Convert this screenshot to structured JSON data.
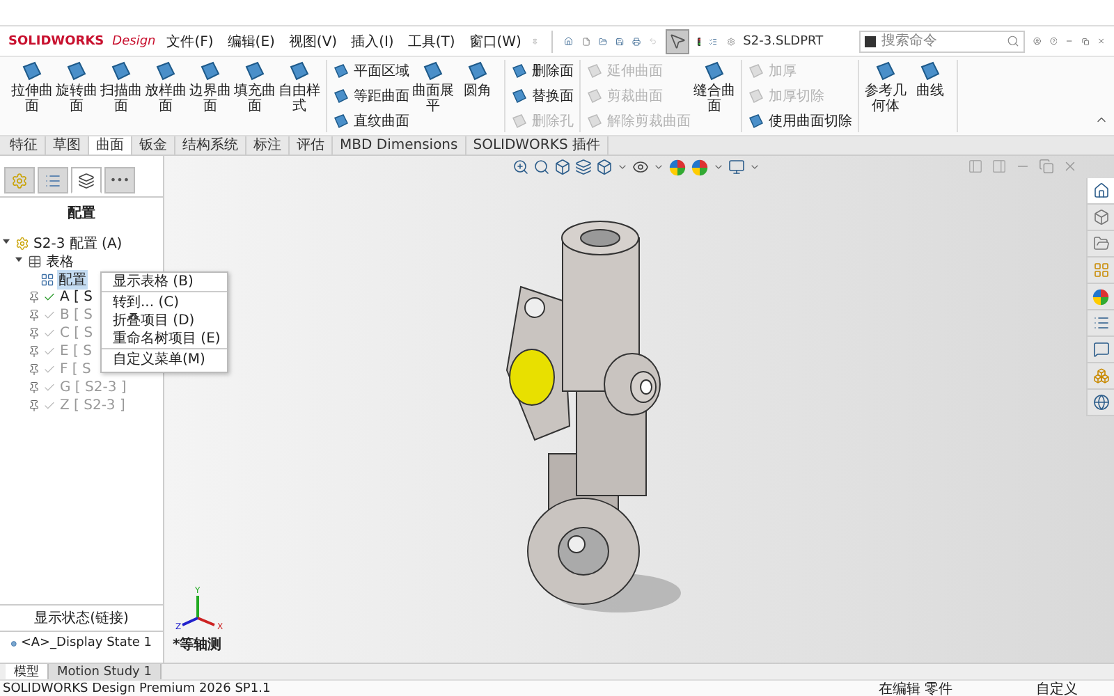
{
  "app": {
    "logo_brand": "SOLIDWORKS",
    "logo_product": "Design",
    "menus": [
      "文件(F)",
      "编辑(E)",
      "视图(V)",
      "插入(I)",
      "工具(T)",
      "窗口(W)"
    ],
    "file_title": "S2-3.SLDPRT",
    "search": {
      "placeholder": "搜索命令"
    }
  },
  "ribbon": {
    "groups": [
      {
        "items": [
          {
            "label": "拉伸曲面",
            "kind": "large",
            "disabled": false
          },
          {
            "label": "旋转曲面",
            "kind": "large",
            "disabled": false
          },
          {
            "label": "扫描曲面",
            "kind": "large",
            "disabled": false
          },
          {
            "label": "放样曲面",
            "kind": "large",
            "disabled": false
          },
          {
            "label": "边界曲面",
            "kind": "large",
            "disabled": false
          },
          {
            "label": "填充曲面",
            "kind": "large",
            "disabled": false
          },
          {
            "label": "自由样式",
            "kind": "large",
            "disabled": false
          }
        ]
      },
      {
        "items": [
          {
            "label": "平面区域",
            "kind": "small",
            "disabled": false
          },
          {
            "label": "等距曲面",
            "kind": "small",
            "disabled": false
          },
          {
            "label": "直纹曲面",
            "kind": "small",
            "disabled": false
          },
          {
            "label": "曲面展平",
            "kind": "large",
            "disabled": false
          },
          {
            "label": "圆角",
            "kind": "large",
            "disabled": false
          }
        ]
      },
      {
        "items": [
          {
            "label": "删除面",
            "kind": "small",
            "disabled": false
          },
          {
            "label": "替换面",
            "kind": "small",
            "disabled": false
          },
          {
            "label": "删除孔",
            "kind": "small",
            "disabled": true
          }
        ]
      },
      {
        "items": [
          {
            "label": "延伸曲面",
            "kind": "small",
            "disabled": true
          },
          {
            "label": "剪裁曲面",
            "kind": "small",
            "disabled": true
          },
          {
            "label": "解除剪裁曲面",
            "kind": "small",
            "disabled": true
          },
          {
            "label": "缝合曲面",
            "kind": "large",
            "disabled": false
          }
        ]
      },
      {
        "items": [
          {
            "label": "加厚",
            "kind": "small",
            "disabled": true
          },
          {
            "label": "加厚切除",
            "kind": "small",
            "disabled": true
          },
          {
            "label": "使用曲面切除",
            "kind": "small",
            "disabled": false
          }
        ]
      },
      {
        "items": [
          {
            "label": "参考几何体",
            "kind": "large",
            "disabled": false
          },
          {
            "label": "曲线",
            "kind": "large",
            "disabled": false
          }
        ]
      }
    ]
  },
  "tabs": [
    {
      "label": "特征",
      "selected": false
    },
    {
      "label": "草图",
      "selected": false
    },
    {
      "label": "曲面",
      "selected": true
    },
    {
      "label": "钣金",
      "selected": false
    },
    {
      "label": "结构系统",
      "selected": false
    },
    {
      "label": "标注",
      "selected": false
    },
    {
      "label": "评估",
      "selected": false
    },
    {
      "label": "MBD Dimensions",
      "selected": false
    },
    {
      "label": "SOLIDWORKS 插件",
      "selected": false
    }
  ],
  "feature_panel": {
    "panel_tabs": [
      {
        "kind": "features",
        "selected": false
      },
      {
        "kind": "properties",
        "selected": false
      },
      {
        "kind": "configurations",
        "selected": true
      },
      {
        "kind": "more",
        "label": "•••",
        "selected": false
      }
    ],
    "title": "配置",
    "tree": [
      {
        "label": "S2-3 配置 (A)",
        "kind": "root",
        "selected": false,
        "expanded": true,
        "children": [
          {
            "label": "表格",
            "kind": "table",
            "selected": false,
            "expanded": true,
            "children": [
              {
                "label": "配置",
                "kind": "design-table",
                "selected": true
              }
            ]
          },
          {
            "label": "A [ S",
            "kind": "config",
            "selected": false,
            "active": true
          },
          {
            "label": "B [ S",
            "kind": "config",
            "selected": false,
            "active": false
          },
          {
            "label": "C [ S",
            "kind": "config",
            "selected": false,
            "active": false
          },
          {
            "label": "E [ S",
            "kind": "config",
            "selected": false,
            "active": false
          },
          {
            "label": "F [ S",
            "kind": "config",
            "selected": false,
            "active": false
          },
          {
            "label": "G [ S2-3 ]",
            "kind": "config",
            "selected": false,
            "active": false
          },
          {
            "label": "Z [ S2-3 ]",
            "kind": "config",
            "selected": false,
            "active": false
          }
        ]
      }
    ],
    "context_menu": {
      "items": [
        {
          "label": "显示表格 (B)",
          "divider_after": true
        },
        {
          "label": "转到... (C)",
          "divider_after": false
        },
        {
          "label": "折叠项目 (D)",
          "divider_after": false
        },
        {
          "label": "重命名树项目 (E)",
          "divider_after": true
        },
        {
          "label": "自定义菜单(M)",
          "divider_after": false
        }
      ]
    },
    "display_states": {
      "title": "显示状态(链接)",
      "items": [
        "<A>_Display State 1"
      ]
    }
  },
  "viewport": {
    "view_label": "*等轴测",
    "triad": {
      "x": "X",
      "y": "Y",
      "z": "Z"
    }
  },
  "bottom_tabs": [
    {
      "label": "模型",
      "selected": true
    },
    {
      "label": "Motion Study 1",
      "selected": false
    }
  ],
  "status_bar": {
    "product": "SOLIDWORKS Design Premium 2026 SP1.1",
    "mode": "在编辑 零件",
    "units": "自定义"
  }
}
